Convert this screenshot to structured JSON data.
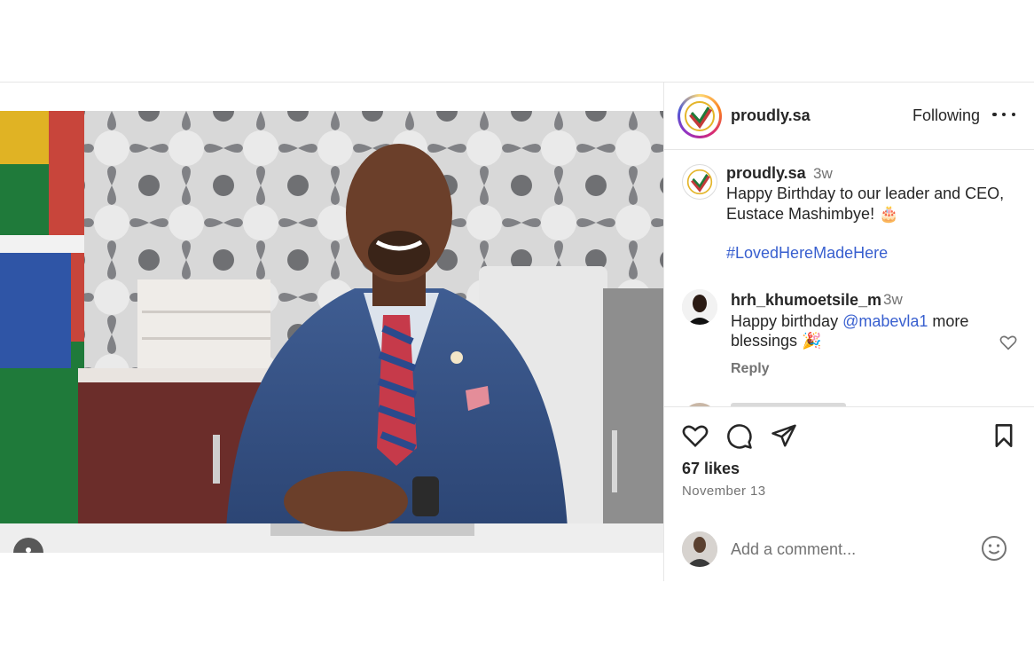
{
  "post": {
    "author": "proudly.sa",
    "follow_status": "Following",
    "caption": {
      "username": "proudly.sa",
      "time": "3w",
      "text": "Happy Birthday to our leader and CEO, Eustace Mashimbye! 🎂",
      "hashtag": "#LovedHereMadeHere"
    },
    "comments": [
      {
        "username": "hrh_khumoetsile_m",
        "time": "3w",
        "text_before": "Happy birthday ",
        "mention": "@mabevla1",
        "text_after": " more blessings 🎉",
        "reply_label": "Reply"
      }
    ],
    "likes": "67 likes",
    "date": "November 13",
    "add_comment_placeholder": "Add a comment..."
  },
  "icons": {
    "more": "more-options-icon",
    "like": "heart-icon",
    "comment": "comment-icon",
    "share": "share-icon",
    "save": "bookmark-icon",
    "emoji": "emoji-icon",
    "tag": "user-tag-icon"
  },
  "colors": {
    "link": "#385FCF",
    "text": "#262626",
    "secondary": "#737373",
    "divider": "#e6e6e6"
  }
}
